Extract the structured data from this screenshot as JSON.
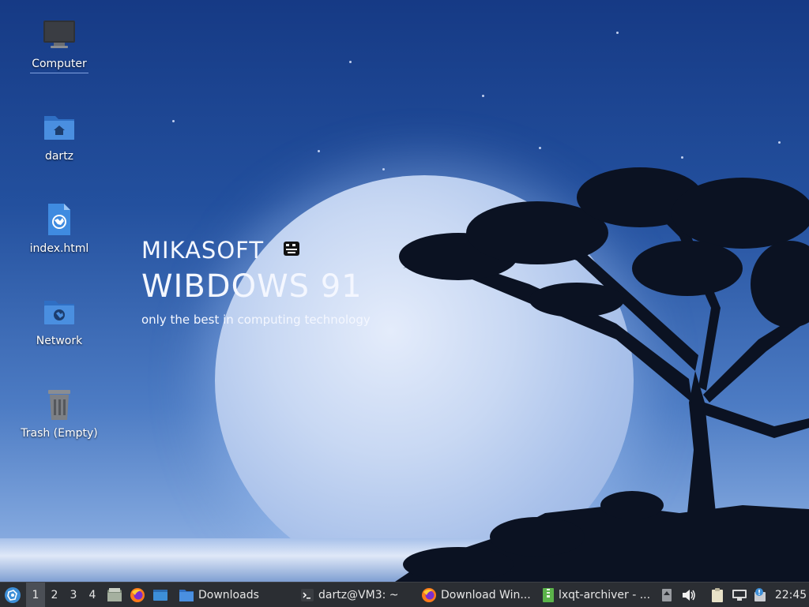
{
  "desktop": {
    "icons": [
      {
        "label": "Computer",
        "icon": "computer-icon"
      },
      {
        "label": "dartz",
        "icon": "home-folder-icon"
      },
      {
        "label": "index.html",
        "icon": "html-file-icon"
      },
      {
        "label": "Network",
        "icon": "network-folder-icon"
      },
      {
        "label": "Trash (Empty)",
        "icon": "trash-icon"
      }
    ]
  },
  "wallpaper": {
    "brand_top": "MIKASOFT",
    "brand_main": "WIBDOWS 91",
    "tagline": "only the best in computing technology"
  },
  "taskbar": {
    "workspaces": [
      "1",
      "2",
      "3",
      "4"
    ],
    "active_workspace": "1",
    "quicklaunch": [
      "file-manager-icon",
      "firefox-icon",
      "show-desktop-icon"
    ],
    "tasks": [
      {
        "label": "Downloads",
        "icon": "folder-icon"
      },
      {
        "label": "dartz@VM3: ~",
        "icon": "terminal-icon"
      },
      {
        "label": "Download Win...",
        "icon": "firefox-icon"
      },
      {
        "label": "lxqt-archiver - ...",
        "icon": "archive-icon"
      }
    ],
    "tray": [
      "upload-icon",
      "volume-icon",
      "clipboard-icon",
      "network-icon",
      "update-notifier-icon"
    ],
    "clock": "22:45"
  },
  "colors": {
    "taskbar_bg": "#2b2e33",
    "folder_blue": "#4a8fe0",
    "menu_accent": "#3d8fd8"
  }
}
